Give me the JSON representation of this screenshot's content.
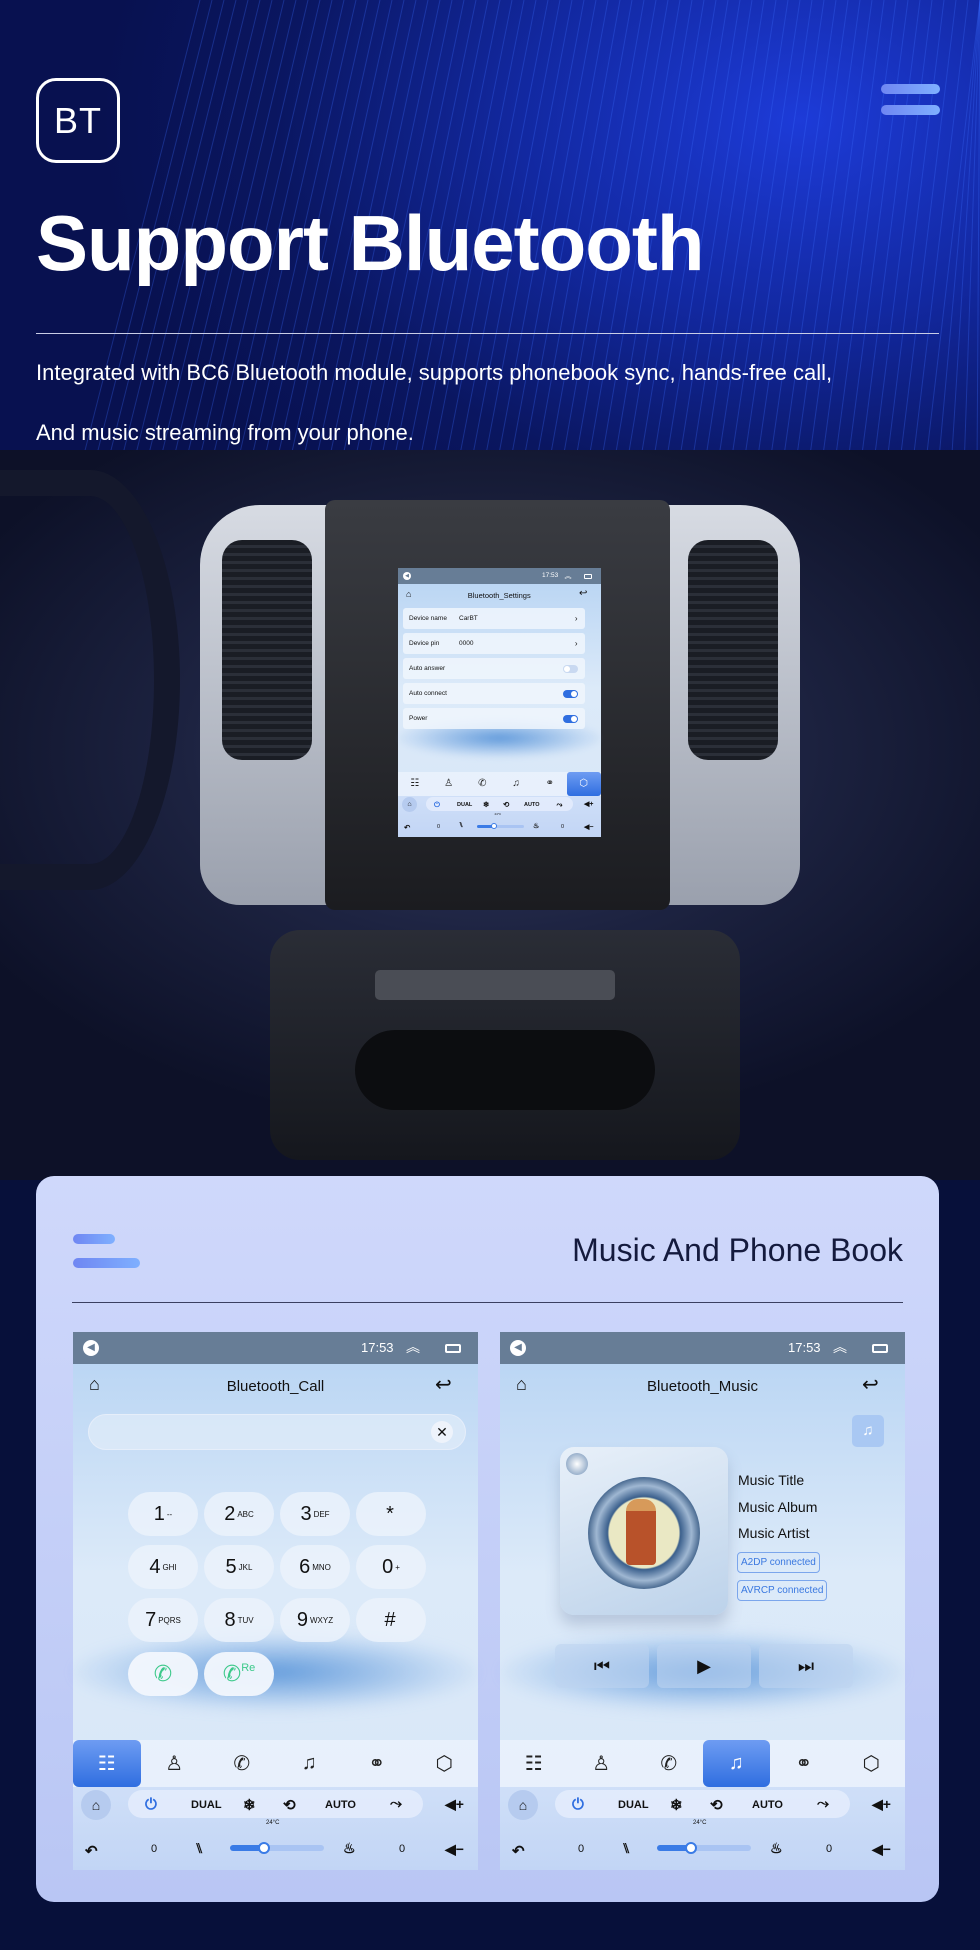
{
  "hero": {
    "badge": "BT",
    "title": "Support Bluetooth",
    "line1": "Integrated with BC6 Bluetooth module, supports phonebook sync, hands-free call,",
    "line2": "And music streaming from your phone."
  },
  "card": {
    "title": "Music And Phone Book"
  },
  "colors": {
    "accent": "#2f6ee0",
    "navy": "#0a1660",
    "call_green": "#3cc98a",
    "status_bar": "#677d96"
  },
  "status": {
    "time": "17:53"
  },
  "climate": {
    "dual": "DUAL",
    "auto": "AUTO",
    "temp": "24°C",
    "left_level": "0",
    "right_level": "0"
  },
  "tabs": [
    "keypad-icon",
    "contacts-icon",
    "call-log-icon",
    "music-icon",
    "link-icon",
    "settings-icon"
  ],
  "settings_screen": {
    "title": "Bluetooth_Settings",
    "rows": [
      {
        "label": "Device name",
        "value": "CarBT",
        "type": "link"
      },
      {
        "label": "Device pin",
        "value": "0000",
        "type": "link"
      },
      {
        "label": "Auto answer",
        "type": "toggle",
        "on": false
      },
      {
        "label": "Auto connect",
        "type": "toggle",
        "on": true
      },
      {
        "label": "Power",
        "type": "toggle",
        "on": true
      }
    ]
  },
  "call_screen": {
    "title": "Bluetooth_Call",
    "input_value": "",
    "keys": [
      {
        "d": "1",
        "l": "--"
      },
      {
        "d": "2",
        "l": "ABC"
      },
      {
        "d": "3",
        "l": "DEF"
      },
      {
        "d": "*",
        "l": ""
      },
      {
        "d": "4",
        "l": "GHI"
      },
      {
        "d": "5",
        "l": "JKL"
      },
      {
        "d": "6",
        "l": "MNO"
      },
      {
        "d": "0",
        "l": "+"
      },
      {
        "d": "7",
        "l": "PQRS"
      },
      {
        "d": "8",
        "l": "TUV"
      },
      {
        "d": "9",
        "l": "WXYZ"
      },
      {
        "d": "#",
        "l": ""
      }
    ],
    "redial_label": "Re"
  },
  "music_screen": {
    "title": "Bluetooth_Music",
    "track_title": "Music Title",
    "album": "Music Album",
    "artist": "Music Artist",
    "badges": [
      "A2DP  connected",
      "AVRCP connected"
    ]
  }
}
